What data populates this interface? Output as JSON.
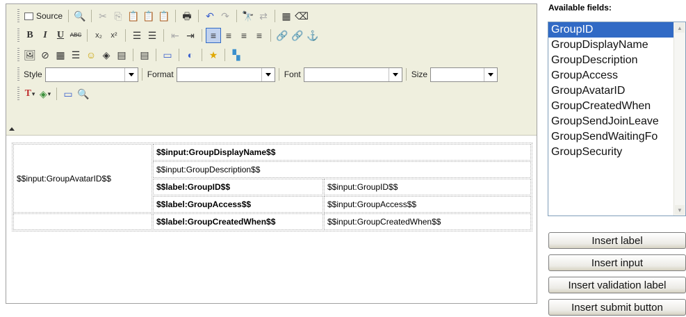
{
  "toolbar": {
    "source_label": "Source",
    "style_label": "Style",
    "format_label": "Format",
    "font_label": "Font",
    "size_label": "Size",
    "style_value": "",
    "format_value": "",
    "font_value": "",
    "size_value": "",
    "icons": {
      "preview": "🔍",
      "cut": "✂",
      "copy": "⎘",
      "paste": "📋",
      "paste_text": "📋",
      "paste_word": "📋",
      "print": "🖶",
      "undo": "↶",
      "redo": "↷",
      "find": "🔭",
      "replace": "⇄",
      "select_all": "▦",
      "remove_format": "⌫",
      "bold": "B",
      "italic": "I",
      "underline": "U",
      "strike": "ABC",
      "subscript": "x₂",
      "superscript": "x²",
      "ordered_list": "☰",
      "unordered_list": "☰",
      "outdent": "⇤",
      "indent": "⇥",
      "align_left": "≡",
      "align_center": "≡",
      "align_right": "≡",
      "align_justify": "≡",
      "link": "🔗",
      "unlink": "🔗",
      "anchor": "⚓",
      "image": "🖼",
      "flash": "⊘",
      "table": "▦",
      "horizontal_rule": "☰",
      "smiley": "☺",
      "special_char": "◈",
      "page_break": "▤",
      "template": "▤",
      "iframe": "▭",
      "globe": "◐",
      "star": "★",
      "chart": "▚",
      "text_color": "T",
      "bg_color": "◈",
      "maximize": "▭",
      "show_blocks": "🔍"
    }
  },
  "content": {
    "avatar_input": "$$input:GroupAvatarID$$",
    "display_name_input": "$$input:GroupDisplayName$$",
    "description_input": "$$input:GroupDescription$$",
    "rows": [
      {
        "label": "$$label:GroupID$$",
        "input": "$$input:GroupID$$"
      },
      {
        "label": "$$label:GroupAccess$$",
        "input": "$$input:GroupAccess$$"
      },
      {
        "label": "$$label:GroupCreatedWhen$$",
        "input": "$$input:GroupCreatedWhen$$"
      }
    ]
  },
  "fields_panel": {
    "heading": "Available fields:",
    "selected_index": 0,
    "items": [
      "GroupID",
      "GroupDisplayName",
      "GroupDescription",
      "GroupAccess",
      "GroupAvatarID",
      "GroupCreatedWhen",
      "GroupSendJoinLeave",
      "GroupSendWaitingFo",
      "GroupSecurity"
    ],
    "buttons": {
      "insert_label": "Insert label",
      "insert_input": "Insert input",
      "insert_validation_label": "Insert validation label",
      "insert_submit_button": "Insert submit button"
    }
  },
  "colors": {
    "toolbar_bg": "#efefde",
    "selection": "#316ac5",
    "list_border": "#7f9db9"
  }
}
